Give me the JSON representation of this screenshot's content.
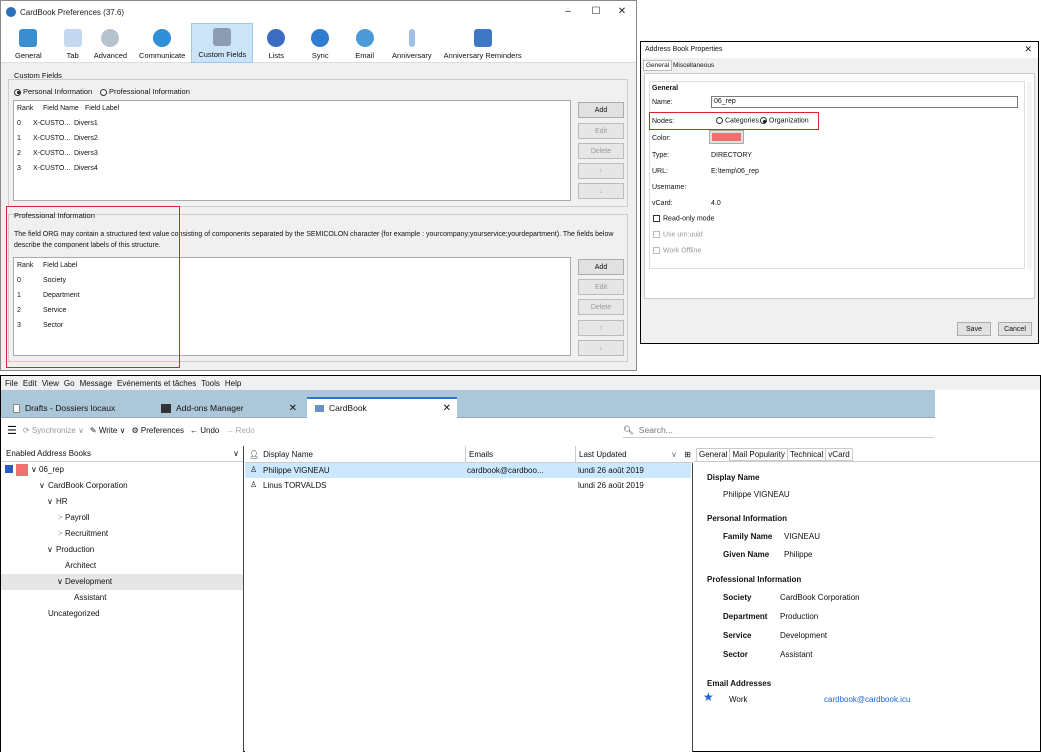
{
  "prefs": {
    "title": "CardBook Preferences (37.6)",
    "window_controls": {
      "minimize": "–",
      "maximize": "☐",
      "close": "✕"
    },
    "toolbar": [
      {
        "label": "General",
        "icon": "book-icon",
        "color": "#3a8fd0"
      },
      {
        "label": "Tab",
        "icon": "tab-icon",
        "color": "#7aa7d6"
      },
      {
        "label": "Advanced",
        "icon": "gears-icon",
        "color": "#8a9bb0"
      },
      {
        "label": "Communicate",
        "icon": "globe-icon",
        "color": "#2f8fd8"
      },
      {
        "label": "Custom Fields",
        "icon": "pencil-icon",
        "color": "#6f7f99"
      },
      {
        "label": "Lists",
        "icon": "people-icon",
        "color": "#3b6ec2"
      },
      {
        "label": "Sync",
        "icon": "sync-icon",
        "color": "#2e7bd0"
      },
      {
        "label": "Email",
        "icon": "email-icon",
        "color": "#4c9ad8"
      },
      {
        "label": "Anniversary",
        "icon": "candle-icon",
        "color": "#5a8fd0"
      },
      {
        "label": "Anniversary Reminders",
        "icon": "reminder-icon",
        "color": "#3e77c4"
      }
    ],
    "custom_fields": {
      "title": "Custom Fields",
      "radio_personal": "Personal Information",
      "radio_professional": "Professional Information",
      "headers": [
        "Rank",
        "Field Name",
        "Field Label"
      ],
      "rows": [
        [
          "0",
          "X-CUSTO...",
          "Divers1"
        ],
        [
          "1",
          "X-CUSTO...",
          "Divers2"
        ],
        [
          "2",
          "X-CUSTO...",
          "Divers3"
        ],
        [
          "3",
          "X-CUSTO...",
          "Divers4"
        ]
      ],
      "buttons": [
        "Add",
        "Edit",
        "Delete",
        "↑",
        "↓"
      ]
    },
    "professional": {
      "title": "Professional Information",
      "description": "The field ORG may contain a structured text value consisting of components separated by the SEMICOLON character (for example : yourcompany;yourservice;yourdepartment). The fields below describe the component labels of this structure.",
      "headers": [
        "Rank",
        "Field Label"
      ],
      "rows": [
        [
          "0",
          "Society"
        ],
        [
          "1",
          "Department"
        ],
        [
          "2",
          "Service"
        ],
        [
          "3",
          "Sector"
        ]
      ],
      "buttons": [
        "Add",
        "Edit",
        "Delete",
        "↑",
        "↓"
      ]
    }
  },
  "dialog": {
    "title": "Address Book Properties",
    "close": "✕",
    "tabs": [
      "General",
      "Miscellaneous"
    ],
    "section": "General",
    "name_label": "Name:",
    "name_value": "06_rep",
    "nodes_label": "Nodes:",
    "nodes_categories": "Categories",
    "nodes_organization": "Organization",
    "color_label": "Color:",
    "color_value": "#f07070",
    "type_label": "Type:",
    "type_value": "DIRECTORY",
    "url_label": "URL:",
    "url_value": "E:\\temp\\06_rep",
    "username_label": "Username:",
    "vcard_label": "vCard:",
    "vcard_value": "4.0",
    "readonly_label": "Read-only mode",
    "urnuuid_label": "Use urn:uuid",
    "offline_label": "Work Offline",
    "save": "Save",
    "cancel": "Cancel"
  },
  "tb": {
    "menu": [
      "File",
      "Edit",
      "View",
      "Go",
      "Message",
      "Evénements et tâches",
      "Tools",
      "Help"
    ],
    "tabs": [
      "Drafts - Dossiers locaux",
      "Add-ons Manager",
      "CardBook"
    ],
    "toolbar": {
      "synchronize": "Synchronize",
      "write": "Write",
      "preferences": "Preferences",
      "undo": "Undo",
      "redo": "Redo",
      "search_placeholder": "Search..."
    },
    "tree_header": "Enabled Address Books",
    "tree": [
      {
        "label": "06_rep",
        "indent": 0,
        "arrow": "∨"
      },
      {
        "label": "CardBook Corporation",
        "indent": 1,
        "arrow": "∨"
      },
      {
        "label": "HR",
        "indent": 2,
        "arrow": "∨"
      },
      {
        "label": "Payroll",
        "indent": 3,
        "arrow": ">"
      },
      {
        "label": "Recruitment",
        "indent": 3,
        "arrow": ">"
      },
      {
        "label": "Production",
        "indent": 2,
        "arrow": "∨"
      },
      {
        "label": "Architect",
        "indent": 3,
        "arrow": ""
      },
      {
        "label": "Development",
        "indent": 3,
        "arrow": "∨"
      },
      {
        "label": "Assistant",
        "indent": 4,
        "arrow": ""
      },
      {
        "label": "Uncategorized",
        "indent": 2,
        "arrow": ""
      }
    ],
    "list_headers": {
      "display": "Display Name",
      "emails": "Emails",
      "updated": "Last Updated"
    },
    "contacts": [
      {
        "name": "Philippe VIGNEAU",
        "email": "cardbook@cardboo...",
        "updated": "lundi 26 août 2019"
      },
      {
        "name": "Linus TORVALDS",
        "email": "",
        "updated": "lundi 26 août 2019"
      }
    ],
    "detail_tabs": [
      "General",
      "Mail Popularity",
      "Technical",
      "vCard"
    ],
    "detail": {
      "display_name_title": "Display Name",
      "display_name": "Philippe VIGNEAU",
      "personal_title": "Personal Information",
      "family_name_label": "Family Name",
      "family_name": "VIGNEAU",
      "given_name_label": "Given Name",
      "given_name": "Philippe",
      "professional_title": "Professional Information",
      "society_label": "Society",
      "society": "CardBook Corporation",
      "department_label": "Department",
      "department": "Production",
      "service_label": "Service",
      "service": "Development",
      "sector_label": "Sector",
      "sector": "Assistant",
      "email_title": "Email Addresses",
      "email_type": "Work",
      "email": "cardbook@cardbook.icu"
    }
  }
}
